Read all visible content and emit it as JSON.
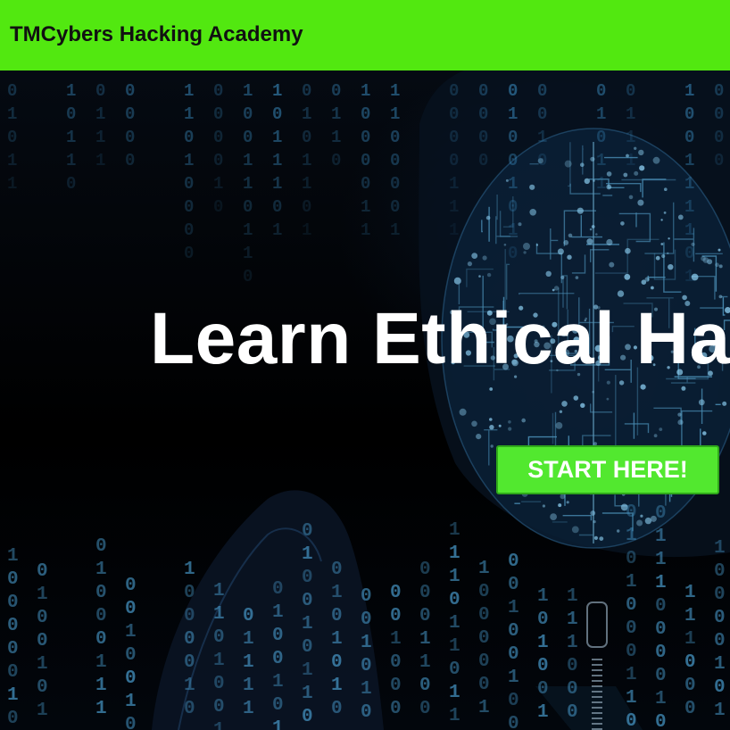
{
  "header": {
    "brand": "TMCybers Hacking Academy",
    "background_color": "#52e810"
  },
  "hero": {
    "headline": "Learn Ethical Hacking",
    "cta_label": "START HERE!",
    "cta_color": "#52e82f",
    "background_image": "hooded-hacker-binary-code-circuit-mask"
  }
}
